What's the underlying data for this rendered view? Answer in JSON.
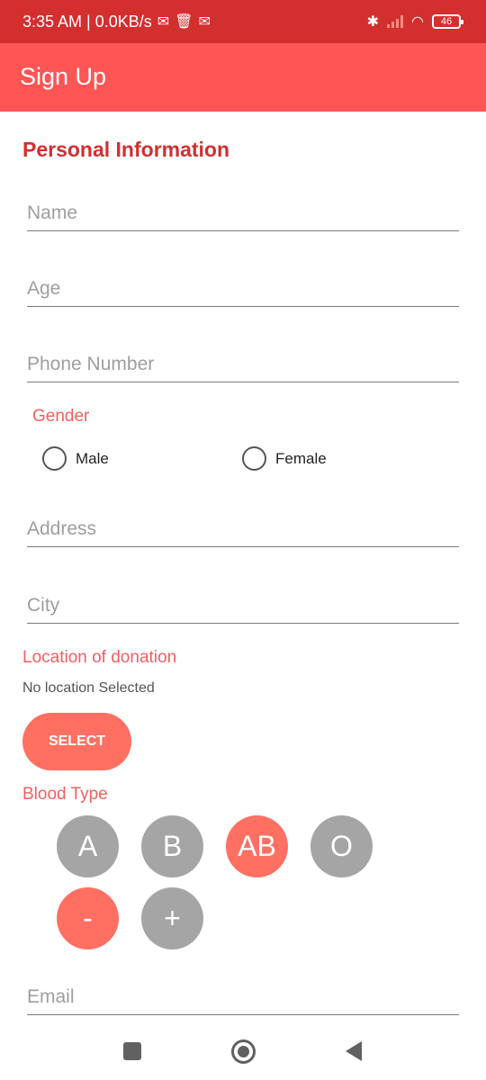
{
  "status_bar": {
    "time_info": "3:35 AM | 0.0KB/s",
    "notification_icons": [
      "gmail-icon",
      "trash-icon",
      "gmail-icon"
    ],
    "system_icons": [
      "bluetooth-icon",
      "signal-icon",
      "wifi-icon",
      "battery-icon"
    ],
    "battery_level": "46"
  },
  "app_bar": {
    "title": "Sign Up"
  },
  "form": {
    "section_title": "Personal Information",
    "name_placeholder": "Name",
    "age_placeholder": "Age",
    "phone_placeholder": "Phone Number",
    "gender_label": "Gender",
    "gender_options": [
      "Male",
      "Female"
    ],
    "gender_selected": null,
    "address_placeholder": "Address",
    "city_placeholder": "City",
    "location_label": "Location of donation",
    "location_value": "No location Selected",
    "select_button": "SELECT",
    "blood_type_label": "Blood Type",
    "blood_groups": [
      "A",
      "B",
      "AB",
      "O"
    ],
    "rh_factors": [
      "-",
      "+"
    ],
    "selected_group": "AB",
    "selected_rh": "-",
    "email_placeholder": "Email"
  },
  "colors": {
    "status_bar": "#d32f2f",
    "app_bar": "#ff5555",
    "accent": "#ff7063",
    "unselected": "#a5a5a5"
  },
  "nav_bar": {
    "icons": [
      "recents-square-icon",
      "home-circle-icon",
      "back-triangle-icon"
    ]
  }
}
